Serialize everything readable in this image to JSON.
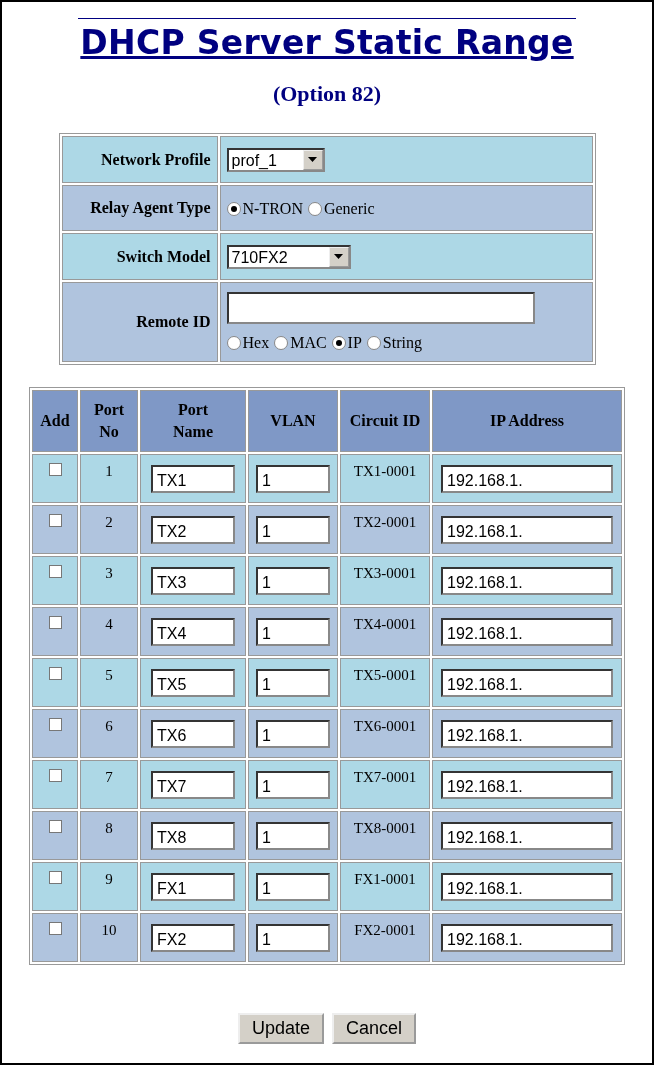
{
  "title": "DHCP Server Static Range",
  "subtitle": "(Option 82)",
  "settings": {
    "network_profile": {
      "label": "Network Profile",
      "value": "prof_1"
    },
    "relay_agent_type": {
      "label": "Relay Agent Type",
      "options": [
        {
          "label": "N-TRON",
          "selected": true
        },
        {
          "label": "Generic",
          "selected": false
        }
      ]
    },
    "switch_model": {
      "label": "Switch Model",
      "value": "710FX2"
    },
    "remote_id": {
      "label": "Remote ID",
      "formats": [
        {
          "label": "Hex",
          "selected": false
        },
        {
          "label": "MAC",
          "selected": false
        },
        {
          "label": "IP",
          "selected": true
        },
        {
          "label": "String",
          "selected": false
        }
      ]
    }
  },
  "table": {
    "columns": [
      "Add",
      "Port No",
      "Port Name",
      "VLAN",
      "Circuit ID",
      "IP Address"
    ],
    "rows": [
      {
        "checked": false,
        "port_no": "1",
        "port_name": "TX1",
        "vlan": "1",
        "circuit_id": "TX1-0001",
        "ip_address": "192.168.1."
      },
      {
        "checked": false,
        "port_no": "2",
        "port_name": "TX2",
        "vlan": "1",
        "circuit_id": "TX2-0001",
        "ip_address": "192.168.1."
      },
      {
        "checked": false,
        "port_no": "3",
        "port_name": "TX3",
        "vlan": "1",
        "circuit_id": "TX3-0001",
        "ip_address": "192.168.1."
      },
      {
        "checked": false,
        "port_no": "4",
        "port_name": "TX4",
        "vlan": "1",
        "circuit_id": "TX4-0001",
        "ip_address": "192.168.1."
      },
      {
        "checked": false,
        "port_no": "5",
        "port_name": "TX5",
        "vlan": "1",
        "circuit_id": "TX5-0001",
        "ip_address": "192.168.1."
      },
      {
        "checked": false,
        "port_no": "6",
        "port_name": "TX6",
        "vlan": "1",
        "circuit_id": "TX6-0001",
        "ip_address": "192.168.1."
      },
      {
        "checked": false,
        "port_no": "7",
        "port_name": "TX7",
        "vlan": "1",
        "circuit_id": "TX7-0001",
        "ip_address": "192.168.1."
      },
      {
        "checked": false,
        "port_no": "8",
        "port_name": "TX8",
        "vlan": "1",
        "circuit_id": "TX8-0001",
        "ip_address": "192.168.1."
      },
      {
        "checked": false,
        "port_no": "9",
        "port_name": "FX1",
        "vlan": "1",
        "circuit_id": "FX1-0001",
        "ip_address": "192.168.1."
      },
      {
        "checked": false,
        "port_no": "10",
        "port_name": "FX2",
        "vlan": "1",
        "circuit_id": "FX2-0001",
        "ip_address": "192.168.1."
      }
    ]
  },
  "buttons": [
    "Update",
    "Cancel"
  ]
}
